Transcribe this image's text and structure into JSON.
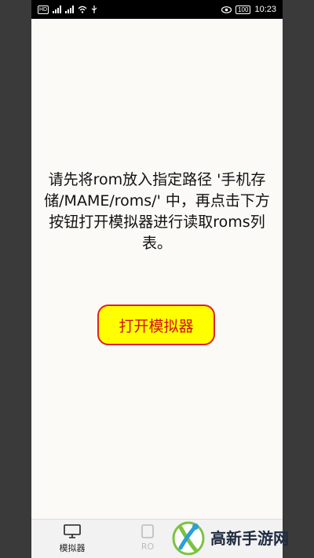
{
  "status_bar": {
    "network_badge": "HD",
    "battery": "100",
    "time": "10:23"
  },
  "main": {
    "instruction_text": "请先将rom放入指定路径 '手机存储/MAME/roms/' 中，再点击下方按钮打开模拟器进行读取roms列表。",
    "open_button_label": "打开模拟器"
  },
  "bottom_nav": {
    "items": [
      {
        "label": "模拟器",
        "icon": "monitor-icon",
        "active": true
      },
      {
        "label": "RO",
        "icon": "rom-icon",
        "active": false
      }
    ]
  },
  "watermark": {
    "text": "高新手游网",
    "icon": "watermark-logo-icon"
  },
  "colors": {
    "button_bg": "#ffff00",
    "button_border": "#dd2222",
    "button_text": "#d01010",
    "page_bg": "#fbfaf6"
  }
}
